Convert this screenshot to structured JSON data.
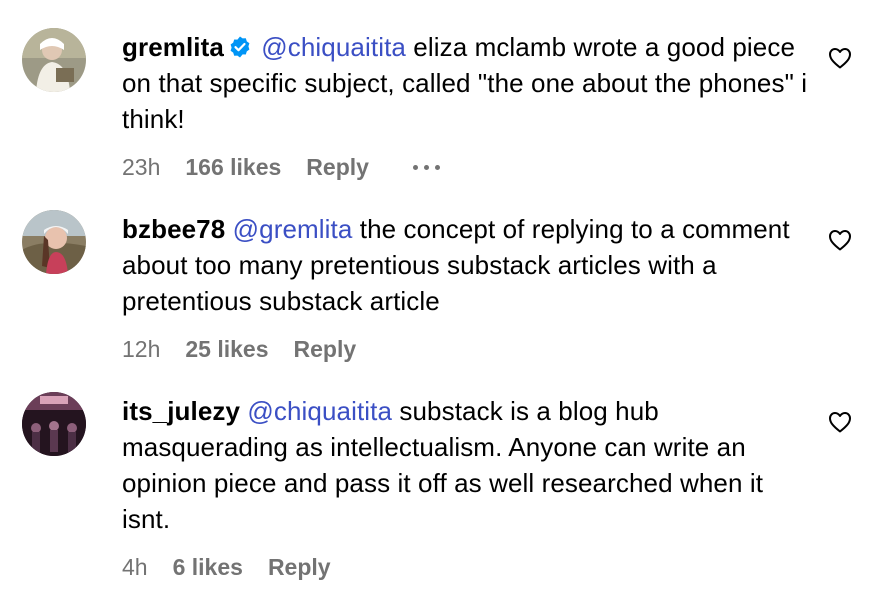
{
  "comments": [
    {
      "username": "gremlita",
      "verified": true,
      "mention": "@chiquaitita",
      "text": " eliza mclamb wrote a good piece on that specific subject, called \"the one about the phones\" i think!",
      "time": "23h",
      "likes": "166 likes",
      "reply": "Reply"
    },
    {
      "username": "bzbee78",
      "verified": false,
      "mention": "@gremlita",
      "text": " the concept of replying to a comment about too many pretentious substack articles with a pretentious substack article",
      "time": "12h",
      "likes": "25 likes",
      "reply": "Reply"
    },
    {
      "username": "its_julezy",
      "verified": false,
      "mention": "@chiquaitita",
      "text": " substack is a blog hub masquerading as intellectualism. Anyone can write an opinion piece and pass it off as well researched when it isnt.",
      "time": "4h",
      "likes": "6 likes",
      "reply": "Reply"
    }
  ],
  "icons": {
    "verified": "verified-badge-icon",
    "like": "heart-outline-icon",
    "more": "more-options-icon"
  },
  "colors": {
    "mention": "#3b4fc4",
    "verified": "#0095f6",
    "meta": "#737373"
  }
}
